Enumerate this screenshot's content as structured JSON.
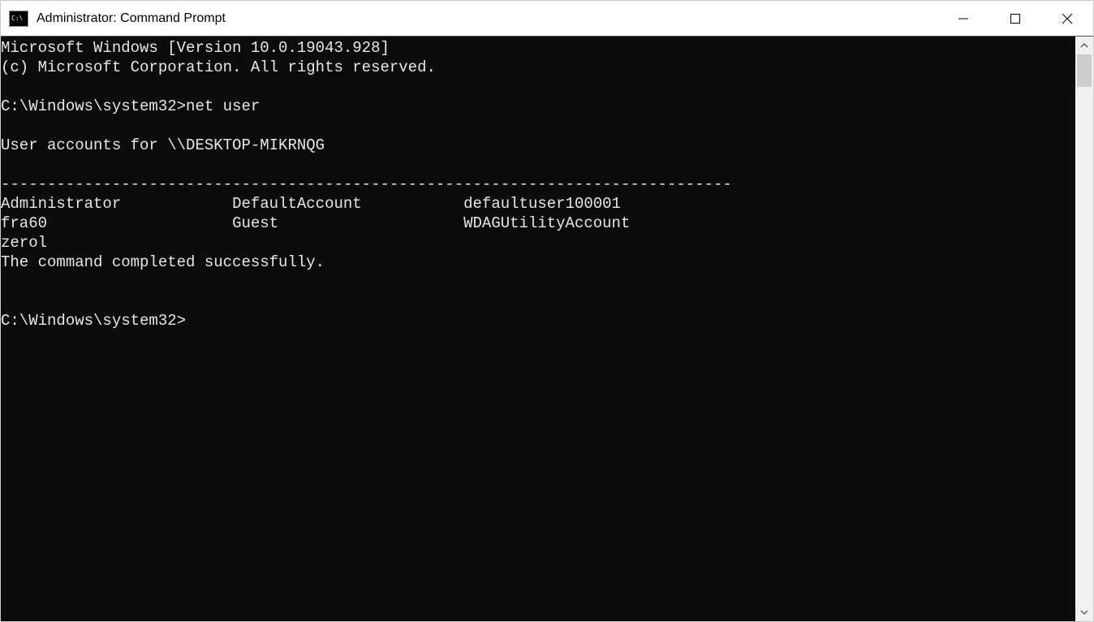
{
  "window": {
    "title": "Administrator: Command Prompt"
  },
  "console": {
    "banner_line1": "Microsoft Windows [Version 10.0.19043.928]",
    "banner_line2": "(c) Microsoft Corporation. All rights reserved.",
    "prompt1": "C:\\Windows\\system32>",
    "command1": "net user",
    "accounts_header": "User accounts for \\\\DESKTOP-MIKRNQG",
    "separator": "-------------------------------------------------------------------------------",
    "row1_col1": "Administrator",
    "row1_col2": "DefaultAccount",
    "row1_col3": "defaultuser100001",
    "row2_col1": "fra60",
    "row2_col2": "Guest",
    "row2_col3": "WDAGUtilityAccount",
    "row3_col1": "zerol",
    "completion_msg": "The command completed successfully.",
    "prompt2": "C:\\Windows\\system32>"
  }
}
